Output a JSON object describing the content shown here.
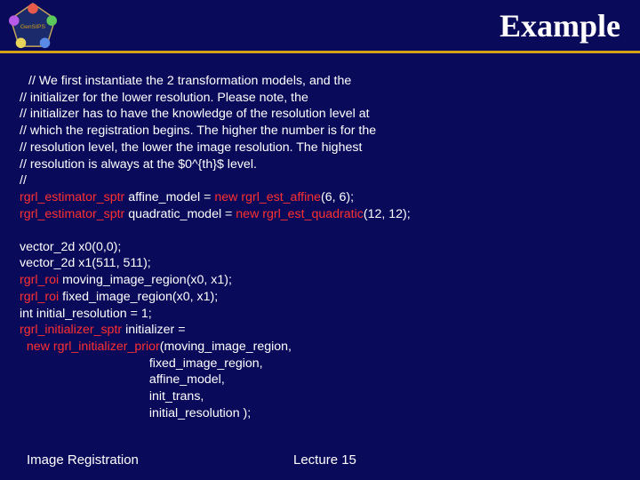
{
  "header": {
    "title": "Example"
  },
  "code": {
    "c1": "// We first instantiate the 2 transformation models, and the",
    "c2": "// initializer for the lower resolution. Please note, the",
    "c3": "// initializer has to have the knowledge of the resolution level at",
    "c4": "// which the registration begins. The higher the number is for the",
    "c5": "// resolution level, the lower the image resolution. The highest",
    "c6": "// resolution is always at the $0^{th}$ level.",
    "c7": "//",
    "kw_estimator": "rgrl_estimator_sptr",
    "l8a": " affine_model = ",
    "kw_new1": "new",
    "l8b": " ",
    "kw_aff": "rgrl_est_affine",
    "l8c": "(6, 6);",
    "l9a": " quadratic_model = ",
    "kw_new2": "new",
    "l9b": " ",
    "kw_quad": "rgrl_est_quadratic",
    "l9c": "(12, 12);",
    "b1": "vector_2d x0(0,0);",
    "b2": "vector_2d x1(511, 511);",
    "kw_roi": "rgrl_roi",
    "b3": " moving_image_region(x0, x1);",
    "b4": " fixed_image_region(x0, x1);",
    "b5": "int initial_resolution = 1;",
    "kw_init_sptr": "rgrl_initializer_sptr",
    "b6": " initializer =",
    "b7a": "  ",
    "kw_new3": "new",
    "b7b": " ",
    "kw_prior": "rgrl_initializer_prior",
    "b7c": "(moving_image_region,",
    "b8": "                                     fixed_image_region,",
    "b9": "                                     affine_model,",
    "b10": "                                     init_trans,",
    "b11": "                                     initial_resolution );"
  },
  "footer": {
    "left": "Image Registration",
    "center": "Lecture 15"
  }
}
